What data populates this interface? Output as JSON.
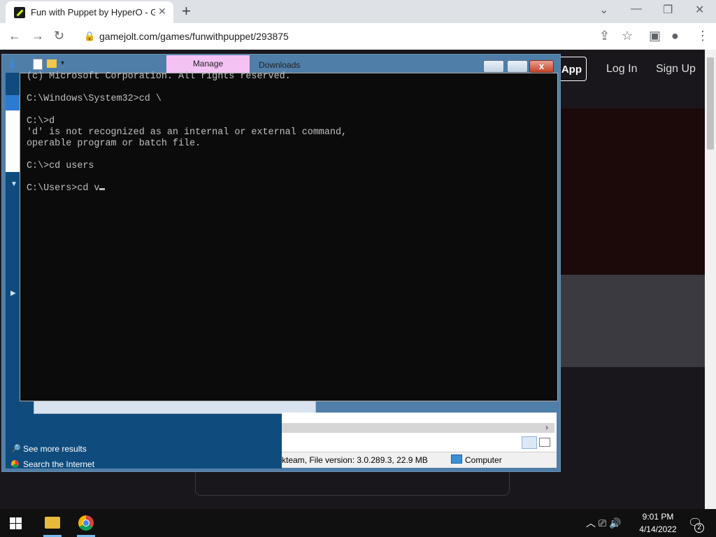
{
  "browser": {
    "tab_title": "Fun with Puppet by HyperO - Ga",
    "tab_close": "✕",
    "new_tab": "+",
    "url": "gamejolt.com/games/funwithpuppet/293875",
    "lock": "🔒",
    "icons": {
      "back": "←",
      "forward": "→",
      "reload": "↻",
      "share": "⇪",
      "star": "☆",
      "sidepanel": "▣",
      "profile": "●",
      "menu": "⋮"
    },
    "window_controls": {
      "minimize": "—",
      "restore": "❐",
      "close": "✕",
      "dropdown": "⌄"
    }
  },
  "site": {
    "app_button": "App",
    "login": "Log In",
    "signup": "Sign Up"
  },
  "explorer": {
    "ribbon_tab_manage": "Manage",
    "ribbon_tab_downloads": "Downloads",
    "status_text": "kteam, File version: 3.0.289.3, 22.9 MB",
    "status_location": "Computer",
    "see_more_results": "See more results",
    "search_internet": "Search the Internet",
    "close_glyph": "x",
    "min_glyph": "▬",
    "max_glyph": "▭"
  },
  "cmd": {
    "lines": [
      "(c) Microsoft Corporation. All rights reserved.",
      "",
      "C:\\Windows\\System32>cd \\",
      "",
      "C:\\>d",
      "'d' is not recognized as an internal or external command,",
      "operable program or batch file.",
      "",
      "C:\\>cd users",
      "",
      "C:\\Users>cd v"
    ]
  },
  "taskbar": {
    "time": "9:01 PM",
    "date": "4/14/2022",
    "notification_count": "2",
    "tray_icons": "︿ ⎚ 🔊"
  }
}
